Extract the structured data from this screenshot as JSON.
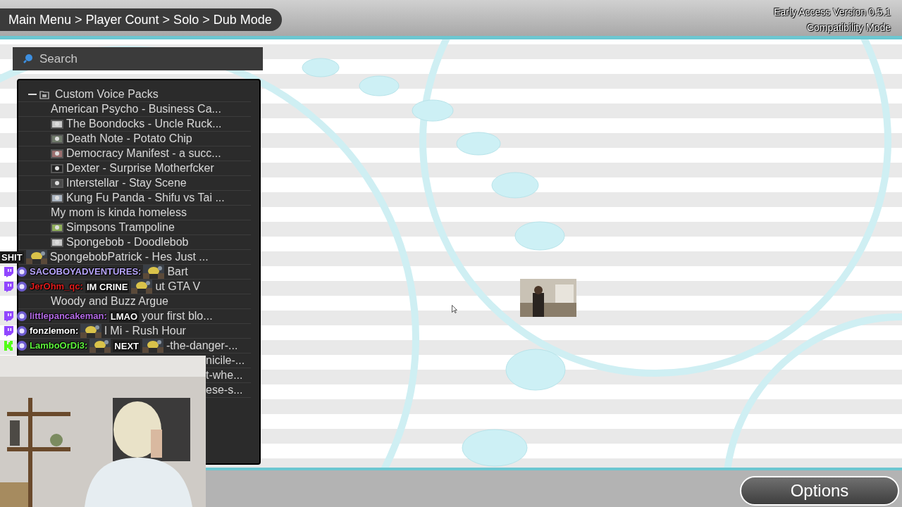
{
  "breadcrumb": "Main Menu > Player Count > Solo > Dub Mode",
  "version": "Early Access Version 0.5.1",
  "mode": "Compatibility Mode",
  "search": {
    "placeholder": "Search"
  },
  "tree": {
    "label": "Custom Voice Packs",
    "expanded": true,
    "children": [
      {
        "kind": "plain",
        "text": "American Psycho - Business Ca..."
      },
      {
        "kind": "thumb",
        "text": "The Boondocks - Uncle Ruck..."
      },
      {
        "kind": "thumb",
        "text": "Death Note - Potato Chip"
      },
      {
        "kind": "thumb",
        "text": "Democracy Manifest - a succ..."
      },
      {
        "kind": "thumb",
        "text": "Dexter - Surprise Motherfcker"
      },
      {
        "kind": "thumb",
        "text": "Interstellar - Stay Scene"
      },
      {
        "kind": "thumb",
        "text": "Kung Fu Panda - Shifu vs Tai ..."
      },
      {
        "kind": "plain",
        "text": "My mom is kinda homeless"
      },
      {
        "kind": "thumb",
        "text": "Simpsons Trampoline"
      },
      {
        "kind": "thumb",
        "text": "Spongebob - Doodlebob"
      },
      {
        "kind": "chat",
        "text": "SpongebobPatrick - Hes Just ...",
        "chat": {
          "parts": [
            {
              "kind": "text",
              "text": "SHIT"
            },
            {
              "kind": "picture"
            }
          ]
        }
      },
      {
        "kind": "chat",
        "text": "Bart",
        "chat": {
          "kind": "twitch",
          "user": "SACOBOYADVENTURES:",
          "color": "#b9a6ff",
          "parts": [
            {
              "kind": "picture"
            }
          ]
        }
      },
      {
        "kind": "chat",
        "text": "ut GTA V",
        "chat": {
          "kind": "twitch",
          "user": "JerOhm_qc:",
          "color": "#e11d1d",
          "parts": [
            {
              "kind": "text",
              "text": "IM CRINE"
            },
            {
              "kind": "picture"
            }
          ]
        }
      },
      {
        "kind": "plain",
        "text": "Woody and Buzz Argue"
      },
      {
        "kind": "chat",
        "text": "your first blo...",
        "chat": {
          "kind": "twitch",
          "user": "littlepancakeman:",
          "color": "#b46be6",
          "parts": [
            {
              "kind": "text",
              "text": "LMAO"
            }
          ]
        }
      },
      {
        "kind": "chat",
        "text": "l Mi - Rush Hour",
        "chat": {
          "kind": "twitch",
          "user": "fonzlemon:",
          "color": "#ffffff",
          "parts": [
            {
              "kind": "picture"
            }
          ]
        }
      },
      {
        "kind": "chat",
        "text": "-the-danger-...",
        "chat": {
          "kind": "kick",
          "user": "LamboOrDi3:",
          "color": "#5df23c",
          "parts": [
            {
              "kind": "picture"
            },
            {
              "kind": "text",
              "text": "NEXT"
            },
            {
              "kind": "picture"
            }
          ]
        }
      },
      {
        "kind": "cam",
        "text": "nicile-..."
      },
      {
        "kind": "cam",
        "text": "t-whe..."
      },
      {
        "kind": "cam",
        "text": "ese-s..."
      }
    ]
  },
  "options_button": "Options"
}
